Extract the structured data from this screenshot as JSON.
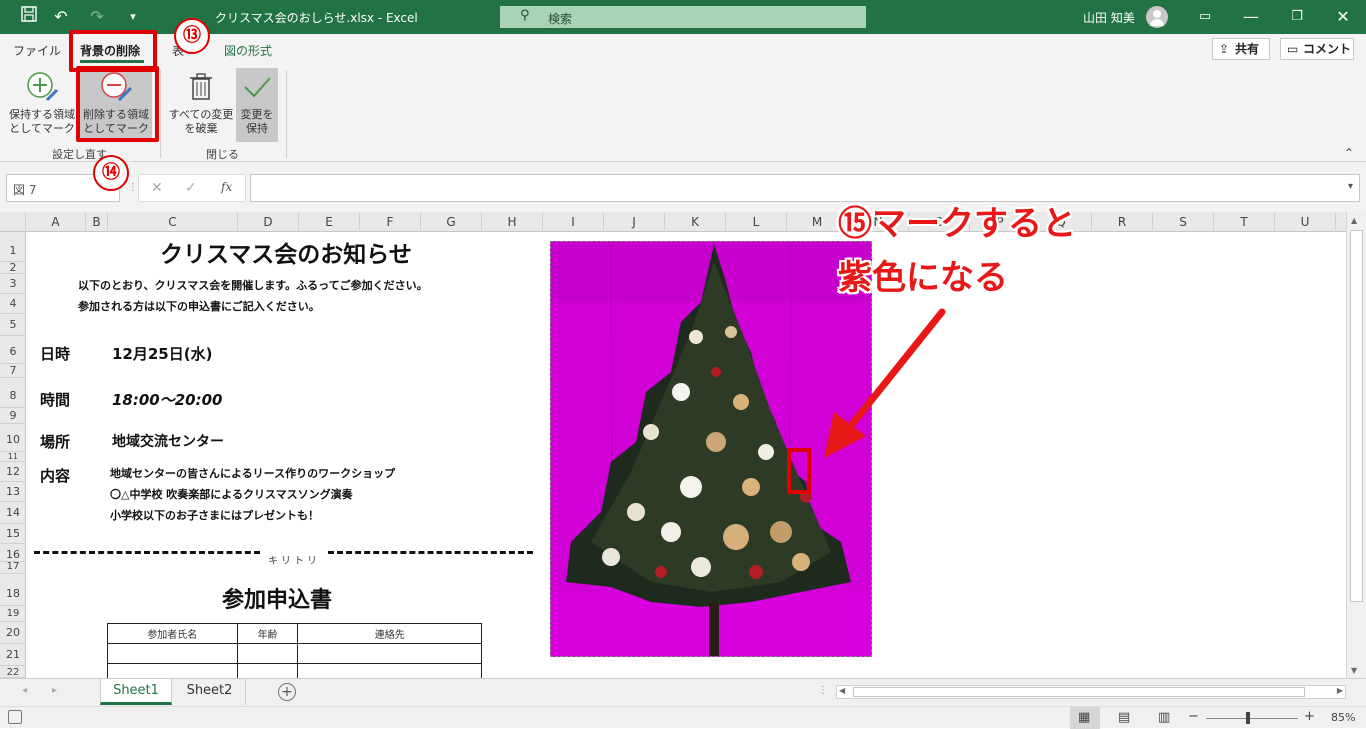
{
  "window": {
    "title": "クリスマス会のおしらせ.xlsx - Excel",
    "search_placeholder": "検索",
    "user_name": "山田 知美"
  },
  "ribbon_tabs": {
    "file": "ファイル",
    "background_removal": "背景の削除",
    "hidden_tab": "表",
    "picture_format": "図の形式",
    "share": "共有",
    "comments": "コメント"
  },
  "ribbon": {
    "mark_keep_line1": "保持する領域",
    "mark_keep_line2": "としてマーク",
    "mark_remove_line1": "削除する領域",
    "mark_remove_line2": "としてマーク",
    "discard_line1": "すべての変更",
    "discard_line2": "を破棄",
    "keep_line1": "変更を",
    "keep_line2": "保持",
    "group_refine": "設定し直す",
    "group_close": "閉じる"
  },
  "formula_bar": {
    "name_box": "図 7",
    "fx": "fx"
  },
  "columns": [
    "A",
    "B",
    "C",
    "D",
    "E",
    "F",
    "G",
    "H",
    "I",
    "J",
    "K",
    "L",
    "M",
    "N",
    "O",
    "P",
    "Q",
    "R",
    "S",
    "T",
    "U"
  ],
  "rows": [
    "1",
    "2",
    "3",
    "4",
    "5",
    "6",
    "7",
    "8",
    "9",
    "10",
    "11",
    "12",
    "13",
    "14",
    "15",
    "16",
    "17",
    "18",
    "19",
    "20",
    "21",
    "22"
  ],
  "document": {
    "title": "クリスマス会のお知らせ",
    "intro_line1": "以下のとおり、クリスマス会を開催します。ふるってご参加ください。",
    "intro_line2": "参加される方は以下の申込書にご記入ください。",
    "date_label": "日時",
    "date_value": "12月25日(水)",
    "time_label": "時間",
    "time_value": "18:00～20:00",
    "place_label": "場所",
    "place_value": "地域交流センター",
    "content_label": "内容",
    "content_line1": "地域センターの皆さんによるリース作りのワークショップ",
    "content_line2": "〇△中学校 吹奏楽部によるクリスマスソング演奏",
    "content_line3": "小学校以下のお子さまにはプレゼントも！",
    "cut_line": "キリトリ",
    "form_title": "参加申込書",
    "form_headers": [
      "参加者氏名",
      "年齢",
      "連絡先"
    ]
  },
  "annotations": {
    "step13": "⑬",
    "step14": "⑭",
    "step15_line1": "⑮マークすると",
    "step15_line2": "紫色になる"
  },
  "sheet_tabs": [
    "Sheet1",
    "Sheet2"
  ],
  "status": {
    "zoom": "85%"
  },
  "colors": {
    "excel_green": "#217346",
    "annotation_red": "#e00000",
    "removal_magenta": "#d000d6"
  }
}
